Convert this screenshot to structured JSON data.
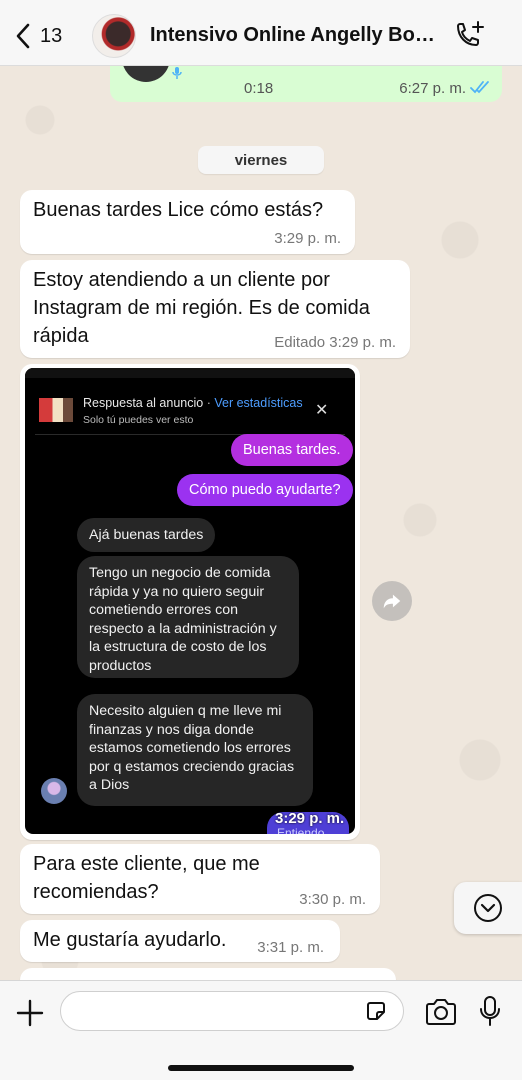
{
  "header": {
    "back_count": "13",
    "chat_title": "Intensivo Online Angelly Bos..."
  },
  "audio_message": {
    "duration": "0:18",
    "time": "6:27 p. m."
  },
  "date_chip": "viernes",
  "messages": [
    {
      "text": "Buenas tardes Lice cómo estás?",
      "time": "3:29 p. m."
    },
    {
      "text": "Estoy atendiendo a un cliente por Instagram de mi región. Es de comida rápida",
      "time": "Editado 3:29 p. m."
    },
    {
      "text": "Para este cliente, que me recomiendas?",
      "time": "3:30 p. m."
    },
    {
      "text": "Me gustaría ayudarlo.",
      "time": "3:31 p. m."
    }
  ],
  "image_message": {
    "ad_label": "Respuesta al anuncio",
    "ad_separator": "·",
    "stats_link": "Ver estadísticas",
    "only_you": "Solo tú puedes ver esto",
    "close_glyph": "✕",
    "ig_outgoing": [
      "Buenas tardes.",
      "Cómo puedo ayudarte?"
    ],
    "ig_incoming": [
      "Ajá buenas tardes",
      "Tengo un negocio de comida rápida y ya no quiero seguir cometiendo errores con respecto a la administración y la estructura de costo de los productos",
      "Necesito alguien q me lleve mi finanzas y nos diga donde estamos cometiendo los errores por q estamos creciendo gracias a Dios"
    ],
    "overlay_time": "3:29 p. m.",
    "sending_label": "Entiendo"
  },
  "composer": {
    "placeholder": ""
  },
  "icons": {
    "back": "chevron-left-icon",
    "call": "add-call-icon",
    "forward": "forward-icon",
    "scroll_down": "chevron-down-icon",
    "plus": "plus-icon",
    "sticker": "sticker-icon",
    "camera": "camera-icon",
    "mic": "microphone-icon"
  },
  "colors": {
    "outgoing_bubble": "#d9fdd3",
    "incoming_bubble": "#ffffff",
    "read_ticks": "#4fb3f6",
    "ig_outgoing_bubble": "#b42fe0",
    "ig_incoming_bubble": "#262626"
  }
}
